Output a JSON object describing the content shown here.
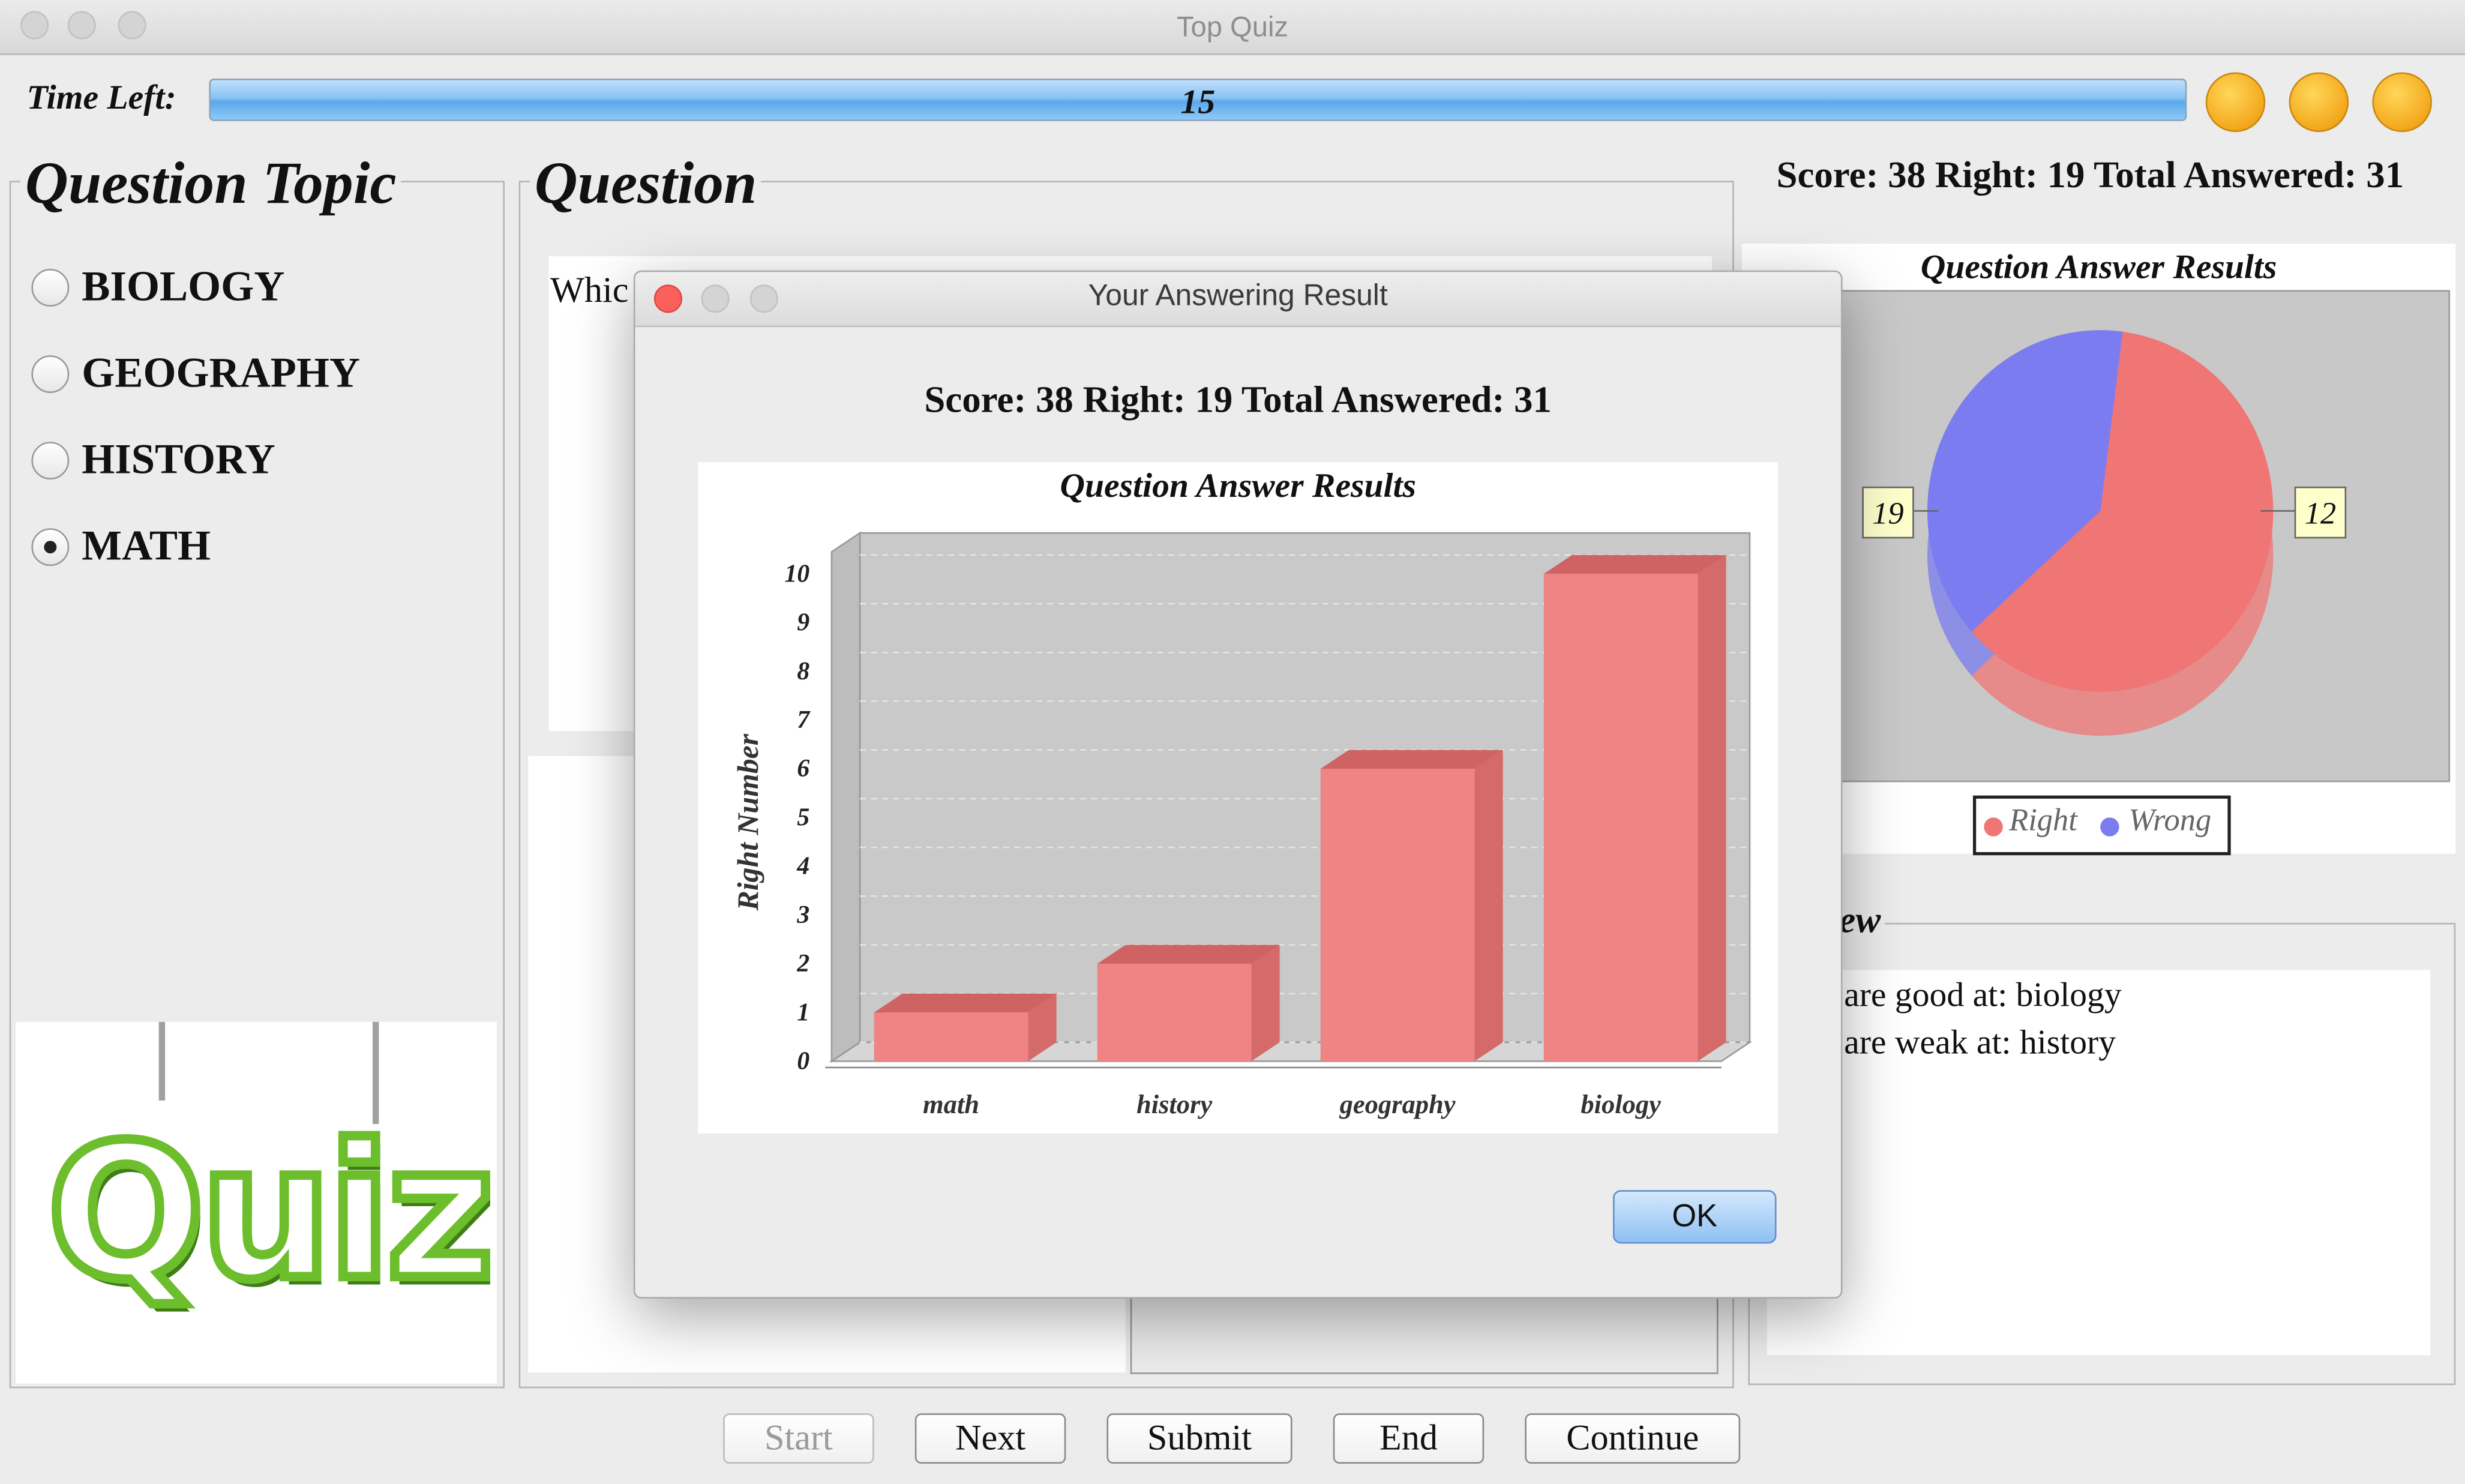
{
  "window": {
    "title": "Top Quiz"
  },
  "timer": {
    "label": "Time Left:",
    "value": "15",
    "fill_fraction": 1.0
  },
  "topics": {
    "title": "Question Topic",
    "items": [
      {
        "label": "BIOLOGY",
        "selected": false
      },
      {
        "label": "GEOGRAPHY",
        "selected": false
      },
      {
        "label": "HISTORY",
        "selected": false
      },
      {
        "label": "MATH",
        "selected": true
      }
    ],
    "logo_text": "Quiz"
  },
  "question": {
    "title": "Question",
    "text_visible": "Whic"
  },
  "score": {
    "text": "Score: 38 Right: 19 Total Answered: 31"
  },
  "side_chart": {
    "title": "Question Answer Results",
    "legend": [
      {
        "label": "Right",
        "color": "#f07575"
      },
      {
        "label": "Wrong",
        "color": "#7a7cf0"
      }
    ]
  },
  "review": {
    "title_partial": "iew",
    "lines": [
      "are good at: biology",
      "are weak at: history"
    ]
  },
  "buttons": {
    "start": "Start",
    "next": "Next",
    "submit": "Submit",
    "end": "End",
    "continue": "Continue"
  },
  "dialog": {
    "title": "Your Answering Result",
    "score": "Score: 38 Right: 19 Total Answered: 31",
    "ok": "OK"
  },
  "chart_data": [
    {
      "type": "bar",
      "title": "Question Answer Results",
      "ylabel": "Right Number",
      "xlabel": "",
      "categories": [
        "math",
        "history",
        "geography",
        "biology"
      ],
      "values": [
        1,
        2,
        6,
        10
      ],
      "ylim": [
        0,
        10
      ],
      "yticks": [
        "0",
        "1",
        "2",
        "3",
        "4",
        "5",
        "6",
        "7",
        "8",
        "9",
        "10"
      ],
      "grid": true,
      "color": "#f08383"
    },
    {
      "type": "pie",
      "title": "Question Answer Results",
      "slices": [
        {
          "label": "Right",
          "value": 19,
          "color": "#f07575"
        },
        {
          "label": "Wrong",
          "value": 12,
          "color": "#7a7cf0"
        }
      ],
      "labels": [
        "19",
        "12"
      ],
      "legend": "bottom"
    }
  ]
}
